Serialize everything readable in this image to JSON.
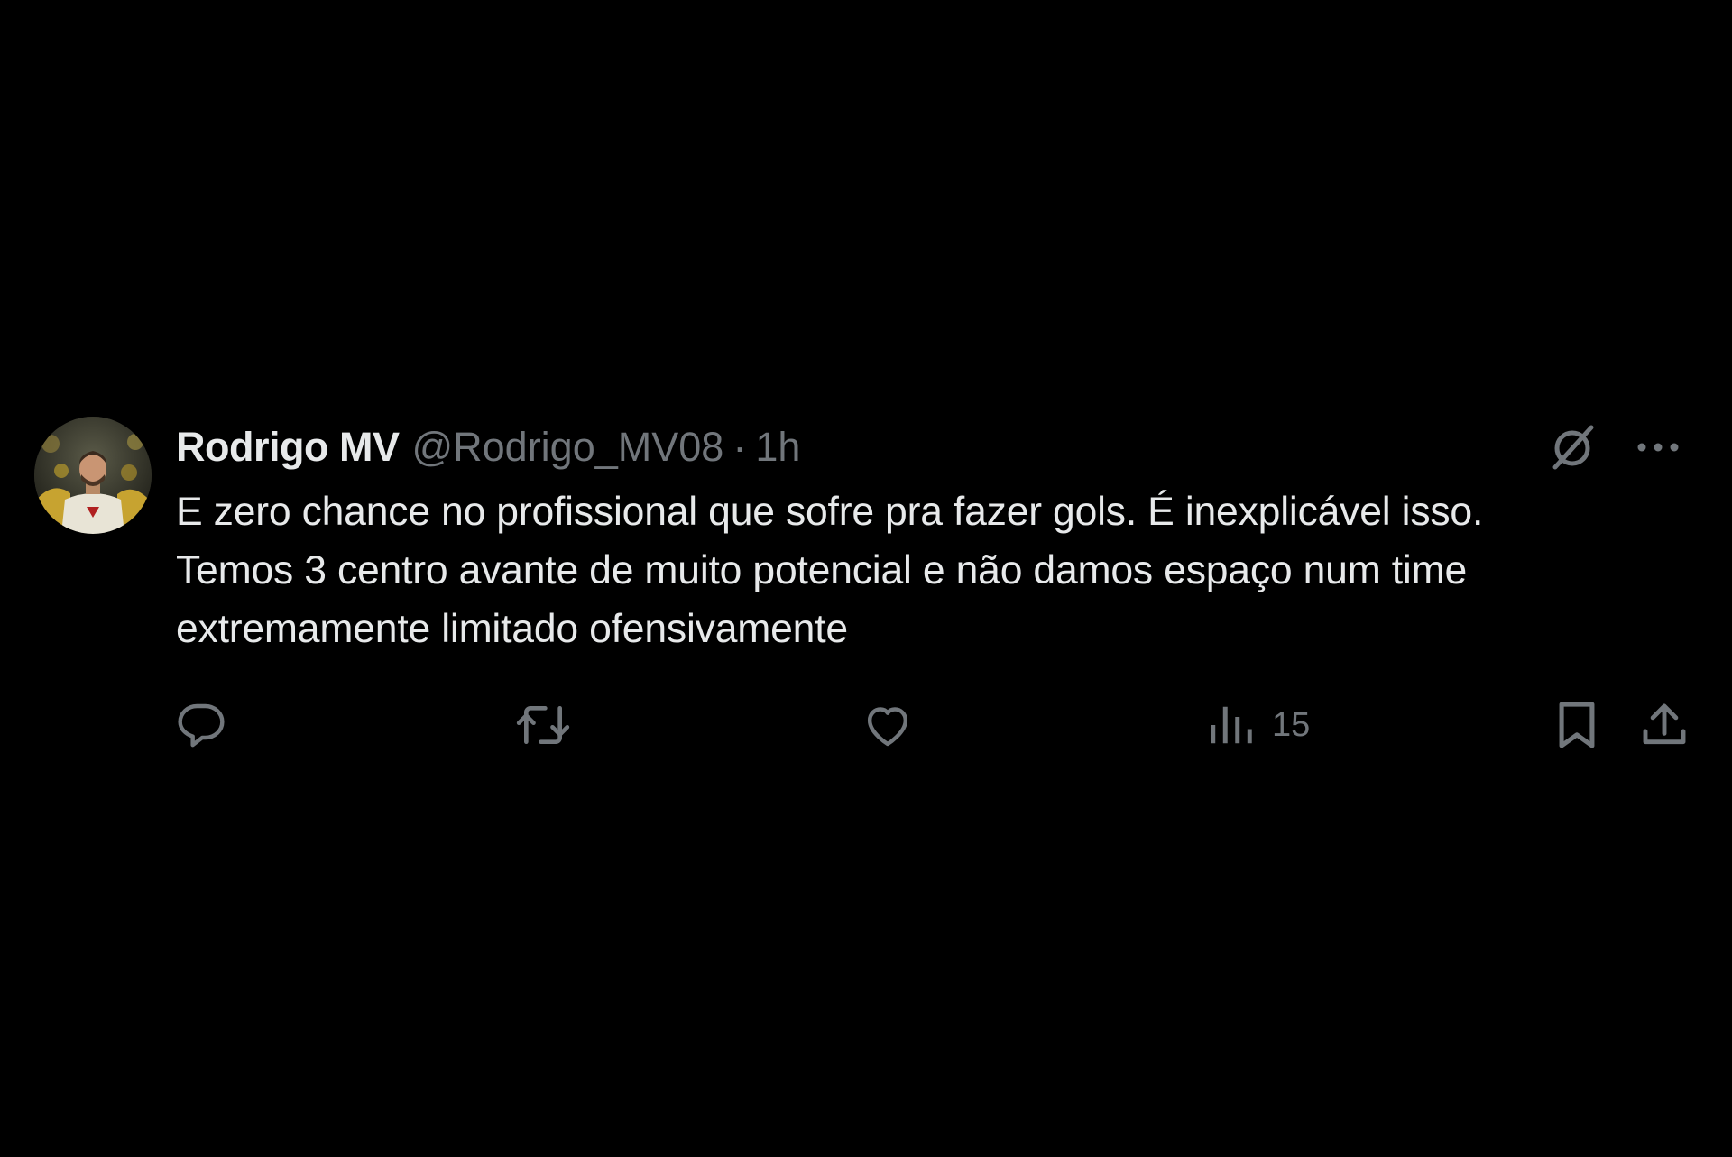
{
  "tweet": {
    "author": {
      "display_name": "Rodrigo MV",
      "handle": "@Rodrigo_MV08",
      "separator": "·",
      "time": "1h"
    },
    "text": "E zero chance no profissional que sofre pra fazer gols. É inexplicável isso.\nTemos 3 centro avante de muito potencial e não damos espaço num time\nextremamente limitado ofensivamente",
    "header_icons": [
      "grok-icon",
      "more-icon"
    ],
    "actions": {
      "reply": {
        "icon": "reply-icon",
        "count": ""
      },
      "retweet": {
        "icon": "retweet-icon",
        "count": ""
      },
      "like": {
        "icon": "heart-icon",
        "count": ""
      },
      "views": {
        "icon": "views-icon",
        "count": "15"
      },
      "bookmark": {
        "icon": "bookmark-icon"
      },
      "share": {
        "icon": "share-icon"
      }
    }
  },
  "colors": {
    "background": "#000000",
    "text_primary": "#e7e9ea",
    "text_secondary": "#71767b"
  }
}
